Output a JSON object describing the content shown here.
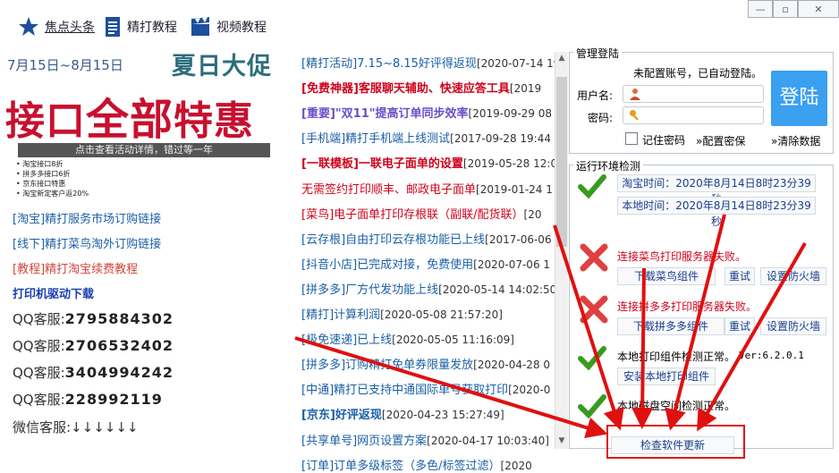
{
  "nav": {
    "headlines": "焦点头条",
    "tutorial": "精打教程",
    "video": "视频教程"
  },
  "banner": {
    "date_range": "7月15日~8月15日",
    "summer": "夏日大促",
    "big_left": "接口",
    "big_mid": "全部",
    "big_right": "特惠",
    "bar_text": "点击查看活动详情，错过等一年",
    "bullets": [
      "淘宝接口8折",
      "拼多多接口6折",
      "京东接口特惠",
      "淘宝新定客户返20%"
    ]
  },
  "left_links": {
    "taobao": "[淘宝]精打服务市场订购链接",
    "offline": "[线下]精打菜鸟淘外订购链接",
    "renew": "[教程]精打淘宝续费教程",
    "driver": "打印机驱动下载"
  },
  "qq": {
    "label": "QQ客服:",
    "numbers": [
      "2795884302",
      "2706532402",
      "3404994242",
      "228992119"
    ],
    "wechat": "微信客服:↓↓↓↓↓↓"
  },
  "news": [
    {
      "title": "[精打活动]7.15~8.15好评得返现",
      "date": "[2020-07-14 19"
    },
    {
      "title": "[免费神器]客服聊天辅助、快速应答工具",
      "date": "[2019"
    },
    {
      "title": "[重要]\"双11\"提高订单同步效率",
      "date": "[2019-09-29 08"
    },
    {
      "title": "[手机端]精打手机端上线测试",
      "date": "[2017-09-28 19:44"
    },
    {
      "title": "[一联模板]一联电子面单的设置",
      "date": "[2019-05-28 12:0"
    },
    {
      "title": "无需签约打印顺丰、邮政电子面单",
      "date": "[2019-01-24 1"
    },
    {
      "title": "[菜鸟]电子面单打印存根联（副联/配货联）",
      "date": "[20"
    },
    {
      "title": "[云存根]自由打印云存根功能已上线",
      "date": "[2017-06-06"
    },
    {
      "title": "[抖音小店]已完成对接，免费使用",
      "date": "[2020-07-06 1"
    },
    {
      "title": "[拼多多]厂方代发功能上线",
      "date": "[2020-05-14 14:02:50"
    },
    {
      "title": "[精打]计算利润",
      "date": "[2020-05-08 21:57:20]"
    },
    {
      "title": "[极免速递]已上线",
      "date": "[2020-05-05 11:16:09]"
    },
    {
      "title": "[拼多多]订购精打免单券限量发放",
      "date": "[2020-04-28 0"
    },
    {
      "title": "[中通]精打已支持中通国际单号获取打印",
      "date": "[2020-0"
    },
    {
      "title": "[京东]好评返现",
      "date": "[2020-04-23 15:27:49]"
    },
    {
      "title": "[共享单号]网页设置方案",
      "date": "[2020-04-17 10:03:40]"
    },
    {
      "title": "[订单]订单多级标签（多色/标签过滤）",
      "date": "[2020"
    }
  ],
  "login": {
    "group_title": "管理登陆",
    "auto_msg": "未配置账号，已自动登陆。",
    "user_label": "用户名:",
    "pwd_label": "密码:",
    "remember": "记住密码",
    "config": "配置密保",
    "clear": "清除数据",
    "login_btn": "登陆"
  },
  "env": {
    "group_title": "运行环境检测",
    "taobao_time": "淘宝时间：2020年8月14日8时23分39秒",
    "local_time": "本地时间：2020年8月14日8时23分39秒",
    "cainiao_err": "连接菜鸟打印服务器失败。",
    "download_cainiao": "下载菜鸟组件",
    "retry": "重试",
    "firewall": "设置防火墙",
    "pdd_err": "连接拼多多打印服务器失败。",
    "download_pdd": "下载拼多多组件",
    "component_ok": "本地打印组件检测正常。",
    "version": "Ver:6.2.0.1",
    "install_component": "安装本地打印组件",
    "disk_ok": "本地磁盘空间检测正常。",
    "check_update": "检查软件更新"
  },
  "colors": {
    "accent_red": "#d0021b",
    "link_blue": "#1b5fa6",
    "login_blue": "#3aa0f0",
    "ok_green": "#3a9a20"
  }
}
